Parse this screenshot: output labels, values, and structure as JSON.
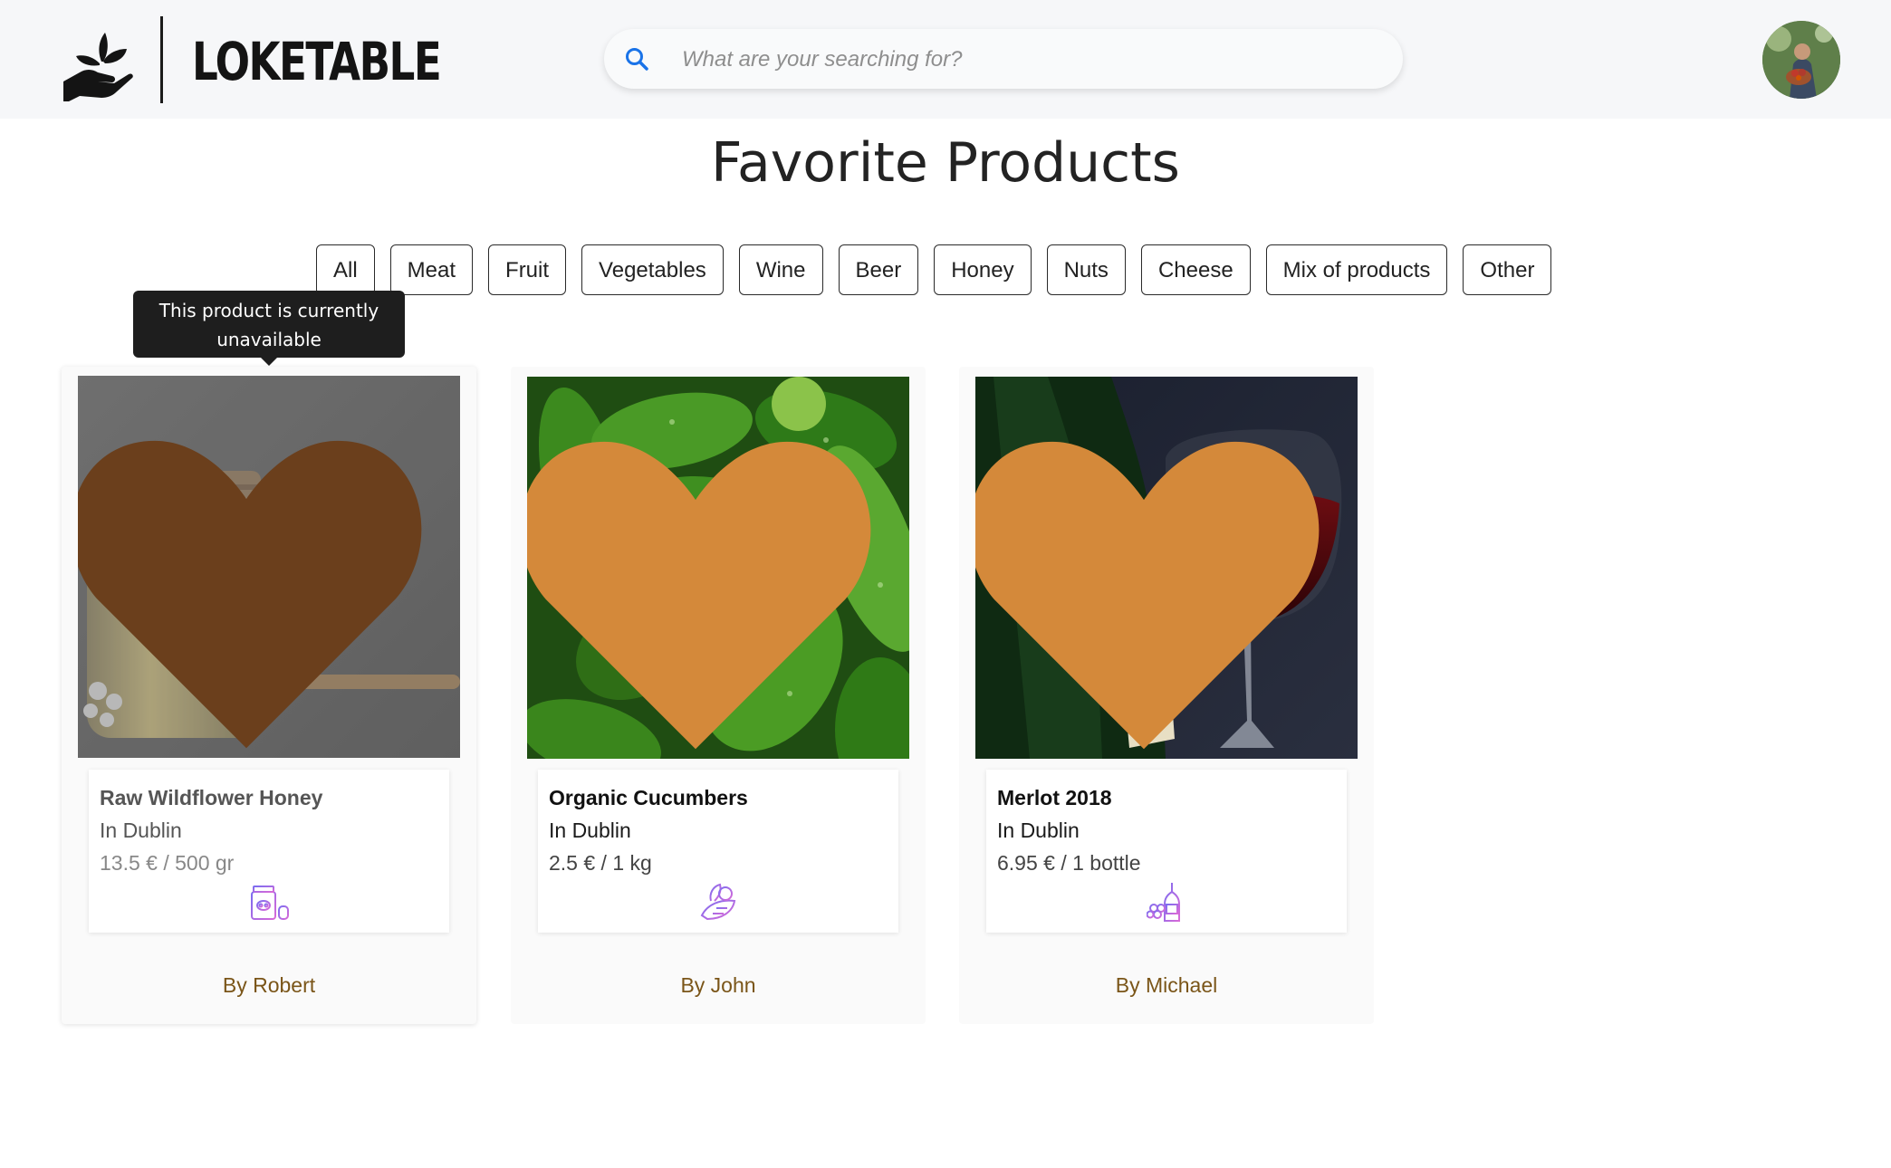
{
  "header": {
    "brand": "LOKETABLE",
    "search": {
      "placeholder": "What are your searching for?",
      "value": ""
    },
    "avatar_alt": "User avatar"
  },
  "page": {
    "title": "Favorite Products"
  },
  "filters": [
    "All",
    "Meat",
    "Fruit",
    "Vegetables",
    "Wine",
    "Beer",
    "Honey",
    "Nuts",
    "Cheese",
    "Mix of products",
    "Other"
  ],
  "tooltip": {
    "line1": "This product is currently",
    "line2": "unavailable"
  },
  "products": [
    {
      "name": "Raw Wildflower Honey",
      "location": "In Dublin",
      "price": "13.5 € / 500 gr",
      "seller": "By Robert",
      "category_icon": "honey-icon",
      "available": false,
      "favorite": true
    },
    {
      "name": "Organic Cucumbers",
      "location": "In Dublin",
      "price": "2.5 € / 1 kg",
      "seller": "By John",
      "category_icon": "vegetables-icon",
      "available": true,
      "favorite": true
    },
    {
      "name": "Merlot 2018",
      "location": "In Dublin",
      "price": "6.95 € / 1 bottle",
      "seller": "By Michael",
      "category_icon": "wine-icon",
      "available": true,
      "favorite": true
    }
  ],
  "colors": {
    "header_bg": "#f6f7f9",
    "heart_active": "#d4893a",
    "heart_dimmed": "#6b3f1c",
    "seller_text": "#7a5518",
    "search_icon": "#1a73e8",
    "category_icon_gradient": [
      "#7b6cf0",
      "#d86ad8"
    ]
  }
}
